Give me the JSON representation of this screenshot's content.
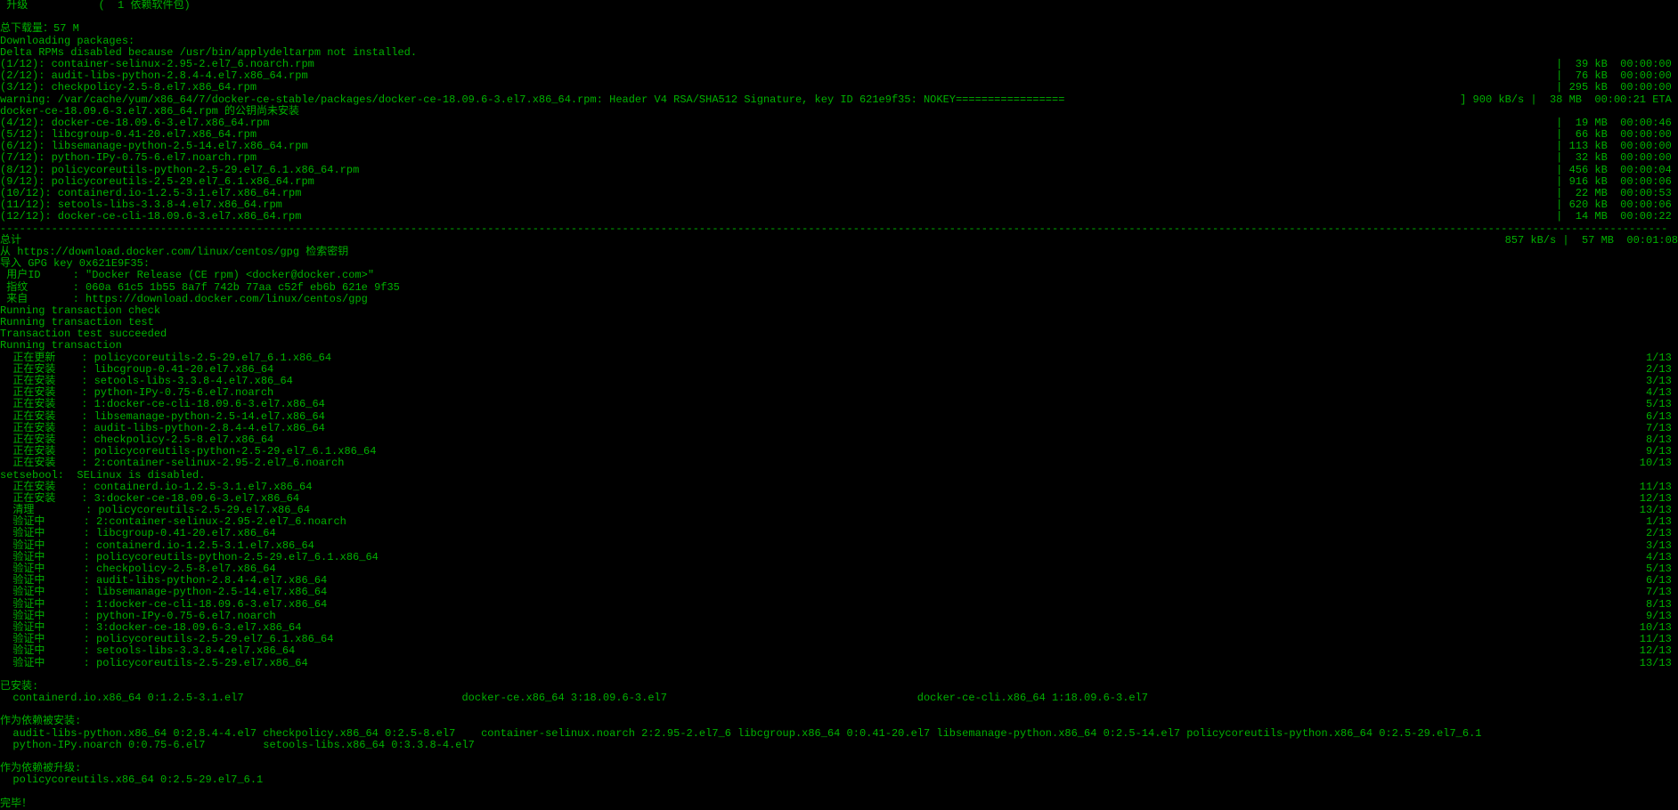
{
  "header": {
    "upgrade": "升级",
    "upgradeCount": "(  1 依赖软件包)",
    "totalDownload": "总下载量：57 M",
    "downloading": "Downloading packages:",
    "deltaRpm": "Delta RPMs disabled because /usr/bin/applydeltarpm not installed."
  },
  "downloads": [
    {
      "l": "(1/12): container-selinux-2.95-2.el7_6.noarch.rpm",
      "r": "|  39 kB  00:00:00"
    },
    {
      "l": "(2/12): audit-libs-python-2.8.4-4.el7.x86_64.rpm",
      "r": "|  76 kB  00:00:00"
    },
    {
      "l": "(3/12): checkpolicy-2.5-8.el7.x86_64.rpm",
      "r": "| 295 kB  00:00:00"
    }
  ],
  "warningLine": {
    "l": "warning: /var/cache/yum/x86_64/7/docker-ce-stable/packages/docker-ce-18.09.6-3.el7.x86_64.rpm: Header V4 RSA/SHA512 Signature, key ID 621e9f35: NOKEY=================    ",
    "r": "] 900 kB/s |  38 MB  00:00:21 ETA "
  },
  "keyNotice": "docker-ce-18.09.6-3.el7.x86_64.rpm 的公钥尚未安装",
  "downloads2": [
    {
      "l": "(4/12): docker-ce-18.09.6-3.el7.x86_64.rpm",
      "r": "|  19 MB  00:00:46"
    },
    {
      "l": "(5/12): libcgroup-0.41-20.el7.x86_64.rpm",
      "r": "|  66 kB  00:00:00"
    },
    {
      "l": "(6/12): libsemanage-python-2.5-14.el7.x86_64.rpm",
      "r": "| 113 kB  00:00:00"
    },
    {
      "l": "(7/12): python-IPy-0.75-6.el7.noarch.rpm",
      "r": "|  32 kB  00:00:00"
    },
    {
      "l": "(8/12): policycoreutils-python-2.5-29.el7_6.1.x86_64.rpm",
      "r": "| 456 kB  00:00:04"
    },
    {
      "l": "(9/12): policycoreutils-2.5-29.el7_6.1.x86_64.rpm",
      "r": "| 916 kB  00:00:06"
    },
    {
      "l": "(10/12): containerd.io-1.2.5-3.1.el7.x86_64.rpm",
      "r": "|  22 MB  00:00:53"
    },
    {
      "l": "(11/12): setools-libs-3.3.8-4.el7.x86_64.rpm",
      "r": "| 620 kB  00:00:06"
    },
    {
      "l": "(12/12): docker-ce-cli-18.09.6-3.el7.x86_64.rpm",
      "r": "|  14 MB  00:00:22"
    }
  ],
  "totals": {
    "l": "总计",
    "r": "857 kB/s |  57 MB  00:01:08"
  },
  "gpg": {
    "retrieve": "从 https://download.docker.com/linux/centos/gpg 检索密钥",
    "import": "导入 GPG key 0x621E9F35:",
    "userid": " 用户ID     : \"Docker Release (CE rpm) <docker@docker.com>\"",
    "fp": " 指纹       : 060a 61c5 1b55 8a7f 742b 77aa c52f eb6b 621e 9f35",
    "source": " 来自       : https://download.docker.com/linux/centos/gpg"
  },
  "trans": {
    "check": "Running transaction check",
    "test": "Running transaction test",
    "ok": "Transaction test succeeded",
    "run": "Running transaction"
  },
  "installSteps": [
    {
      "l": "  正在更新    : policycoreutils-2.5-29.el7_6.1.x86_64",
      "r": " 1/13"
    },
    {
      "l": "  正在安装    : libcgroup-0.41-20.el7.x86_64",
      "r": " 2/13"
    },
    {
      "l": "  正在安装    : setools-libs-3.3.8-4.el7.x86_64",
      "r": " 3/13"
    },
    {
      "l": "  正在安装    : python-IPy-0.75-6.el7.noarch",
      "r": " 4/13"
    },
    {
      "l": "  正在安装    : 1:docker-ce-cli-18.09.6-3.el7.x86_64",
      "r": " 5/13"
    },
    {
      "l": "  正在安装    : libsemanage-python-2.5-14.el7.x86_64",
      "r": " 6/13"
    },
    {
      "l": "  正在安装    : audit-libs-python-2.8.4-4.el7.x86_64",
      "r": " 7/13"
    },
    {
      "l": "  正在安装    : checkpolicy-2.5-8.el7.x86_64",
      "r": " 8/13"
    },
    {
      "l": "  正在安装    : policycoreutils-python-2.5-29.el7_6.1.x86_64",
      "r": " 9/13"
    },
    {
      "l": "  正在安装    : 2:container-selinux-2.95-2.el7_6.noarch",
      "r": "10/13"
    }
  ],
  "selinuxDisabled": "setsebool:  SELinux is disabled.",
  "installSteps2": [
    {
      "l": "  正在安装    : containerd.io-1.2.5-3.1.el7.x86_64",
      "r": "11/13"
    },
    {
      "l": "  正在安装    : 3:docker-ce-18.09.6-3.el7.x86_64",
      "r": "12/13"
    },
    {
      "l": "  清理        : policycoreutils-2.5-29.el7.x86_64",
      "r": "13/13"
    },
    {
      "l": "  验证中      : 2:container-selinux-2.95-2.el7_6.noarch",
      "r": " 1/13"
    },
    {
      "l": "  验证中      : libcgroup-0.41-20.el7.x86_64",
      "r": " 2/13"
    },
    {
      "l": "  验证中      : containerd.io-1.2.5-3.1.el7.x86_64",
      "r": " 3/13"
    },
    {
      "l": "  验证中      : policycoreutils-python-2.5-29.el7_6.1.x86_64",
      "r": " 4/13"
    },
    {
      "l": "  验证中      : checkpolicy-2.5-8.el7.x86_64",
      "r": " 5/13"
    },
    {
      "l": "  验证中      : audit-libs-python-2.8.4-4.el7.x86_64",
      "r": " 6/13"
    },
    {
      "l": "  验证中      : libsemanage-python-2.5-14.el7.x86_64",
      "r": " 7/13"
    },
    {
      "l": "  验证中      : 1:docker-ce-cli-18.09.6-3.el7.x86_64",
      "r": " 8/13"
    },
    {
      "l": "  验证中      : python-IPy-0.75-6.el7.noarch",
      "r": " 9/13"
    },
    {
      "l": "  验证中      : 3:docker-ce-18.09.6-3.el7.x86_64",
      "r": "10/13"
    },
    {
      "l": "  验证中      : policycoreutils-2.5-29.el7_6.1.x86_64",
      "r": "11/13"
    },
    {
      "l": "  验证中      : setools-libs-3.3.8-4.el7.x86_64",
      "r": "12/13"
    },
    {
      "l": "  验证中      : policycoreutils-2.5-29.el7.x86_64",
      "r": "13/13"
    }
  ],
  "summary": {
    "installedLabel": "已安装:",
    "installedLine": "  containerd.io.x86_64 0:1.2.5-3.1.el7                                  docker-ce.x86_64 3:18.09.6-3.el7                                       docker-ce-cli.x86_64 1:18.09.6-3.el7",
    "depInstalledLabel": "作为依赖被安装:",
    "depLine1": "  audit-libs-python.x86_64 0:2.8.4-4.el7 checkpolicy.x86_64 0:2.5-8.el7    container-selinux.noarch 2:2.95-2.el7_6 libcgroup.x86_64 0:0.41-20.el7 libsemanage-python.x86_64 0:2.5-14.el7 policycoreutils-python.x86_64 0:2.5-29.el7_6.1",
    "depLine2": "  python-IPy.noarch 0:0.75-6.el7         setools-libs.x86_64 0:3.3.8-4.el7",
    "depUpgradedLabel": "作为依赖被升级:",
    "depUpgradedLine": "  policycoreutils.x86_64 0:2.5-29.el7_6.1",
    "done": "完毕！"
  }
}
